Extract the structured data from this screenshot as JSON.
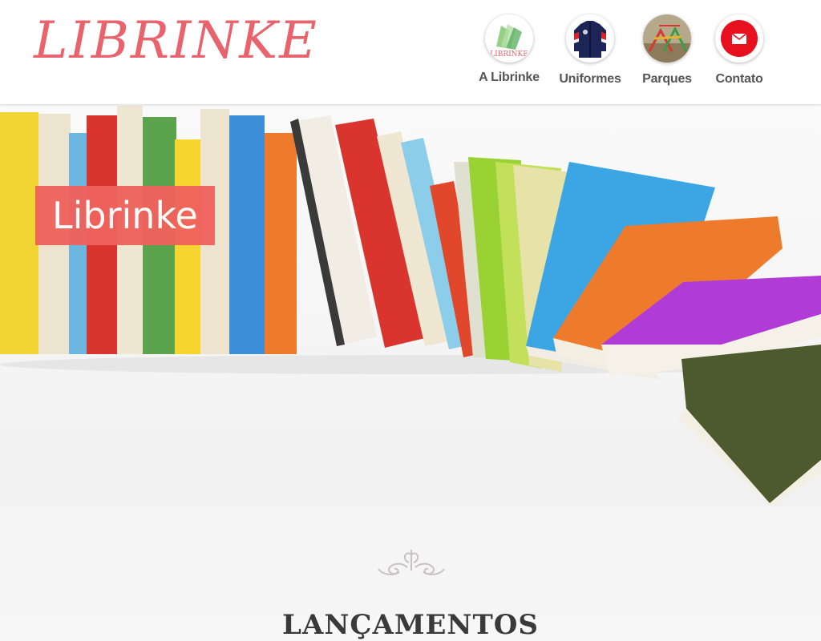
{
  "header": {
    "logo": "LIBRINKE",
    "nav": [
      {
        "label": "A Librinke",
        "icon": "librinke-logo-thumbnail"
      },
      {
        "label": "Uniformes",
        "icon": "uniform-jacket-thumbnail"
      },
      {
        "label": "Parques",
        "icon": "playground-thumbnail"
      },
      {
        "label": "Contato",
        "icon": "envelope-icon"
      }
    ],
    "thumb_logo_text": "LIBRINKE"
  },
  "hero": {
    "badge": "Librinke"
  },
  "section": {
    "title": "LANÇAMENTOS"
  },
  "colors": {
    "brand": "#e8636c",
    "badge": "#f0625d",
    "contact_icon": "#e8101e",
    "nav_text": "#555555"
  }
}
